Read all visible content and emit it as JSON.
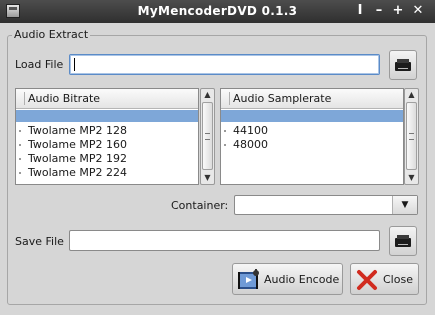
{
  "window": {
    "title": "MyMencoderDVD 0.1.3",
    "controls": [
      "I",
      "–",
      "+",
      "✕"
    ]
  },
  "group": {
    "title": "Audio Extract"
  },
  "load_file": {
    "label": "Load File",
    "value": ""
  },
  "bitrate_list": {
    "header": "Audio Bitrate",
    "items": [
      "Twolame MP2 128",
      "Twolame MP2 160",
      "Twolame MP2 192",
      "Twolame MP2 224"
    ]
  },
  "samplerate_list": {
    "header": "Audio Samplerate",
    "items": [
      "44100",
      "48000"
    ]
  },
  "container": {
    "label": "Container:",
    "value": ""
  },
  "save_file": {
    "label": "Save File",
    "value": ""
  },
  "buttons": {
    "encode": "Audio Encode",
    "close": "Close"
  },
  "colors": {
    "selection": "#7ea7d8",
    "titlebar": "#3a3a3a",
    "close_x": "#d12b1f"
  }
}
